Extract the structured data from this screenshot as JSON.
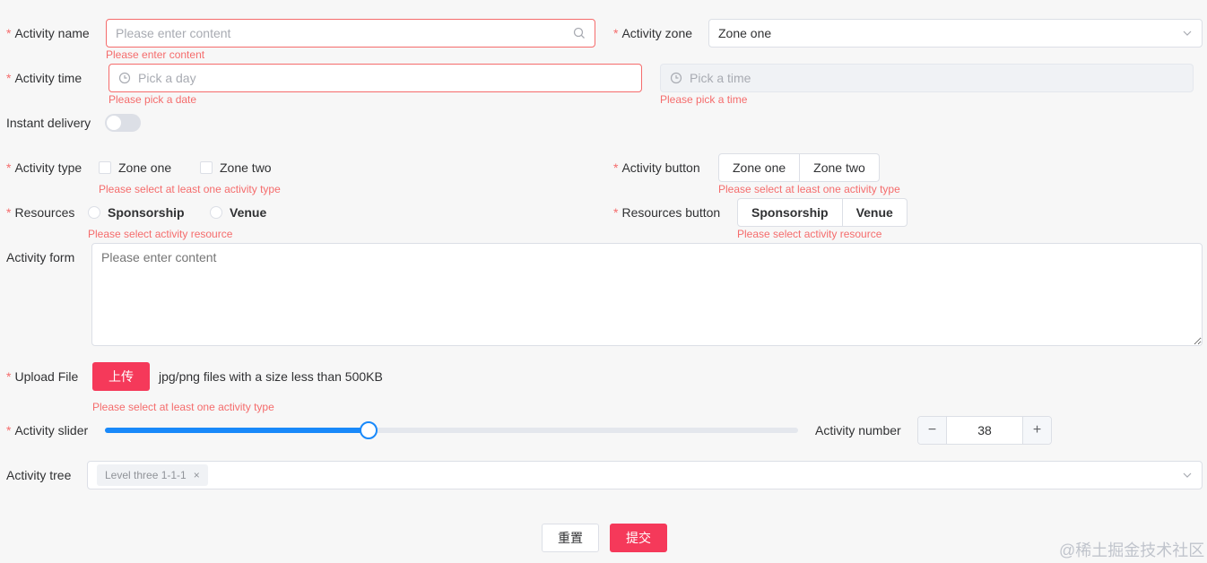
{
  "required_mark": "*",
  "activity_name": {
    "label": "Activity name",
    "placeholder": "Please enter content",
    "error": "Please enter content",
    "icon": "search-icon"
  },
  "activity_zone": {
    "label": "Activity zone",
    "value": "Zone one",
    "icon": "chevron-down-icon"
  },
  "activity_time": {
    "label": "Activity time",
    "date_placeholder": "Pick a day",
    "date_error": "Please pick a date",
    "time_placeholder": "Pick a time",
    "time_error": "Please pick a time",
    "icon": "clock-icon"
  },
  "instant_delivery": {
    "label": "Instant delivery",
    "on": false
  },
  "activity_type": {
    "label": "Activity type",
    "options": [
      "Zone one",
      "Zone two"
    ],
    "error": "Please select at least one activity type"
  },
  "activity_button": {
    "label": "Activity button",
    "options": [
      "Zone one",
      "Zone two"
    ],
    "error": "Please select at least one activity type"
  },
  "resources": {
    "label": "Resources",
    "options": [
      "Sponsorship",
      "Venue"
    ],
    "error": "Please select activity resource"
  },
  "resources_button": {
    "label": "Resources button",
    "options": [
      "Sponsorship",
      "Venue"
    ],
    "error": "Please select activity resource"
  },
  "activity_form": {
    "label": "Activity form",
    "placeholder": "Please enter content"
  },
  "upload": {
    "label": "Upload File",
    "button": "上传",
    "hint": "jpg/png files with a size less than 500KB",
    "error": "Please select at least one activity type"
  },
  "slider": {
    "label": "Activity slider",
    "value_fraction": 0.38,
    "color": "#1989fa"
  },
  "activity_number": {
    "label": "Activity number",
    "value": "38",
    "minus": "−",
    "plus": "+"
  },
  "activity_tree": {
    "label": "Activity tree",
    "tag": "Level three 1-1-1",
    "tag_close": "×",
    "icon": "chevron-down-icon"
  },
  "actions": {
    "reset": "重置",
    "submit": "提交",
    "primary_color": "#f5395a"
  },
  "watermark": "@稀土掘金技术社区"
}
